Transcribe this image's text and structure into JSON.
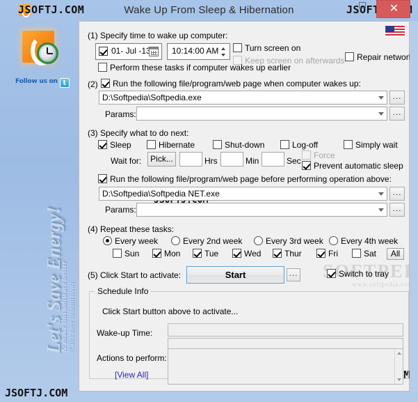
{
  "window": {
    "title": "Wake Up From Sleep & Hibernation",
    "watermark_titlebar_left": "JSOFTJ.COM",
    "watermark_titlebar_right": "JSOFTJ.COM",
    "watermark_bottom_left": "JSOFTJ.COM",
    "watermark_bottom_right": "JSOFTJ.COM",
    "watermark_middle": "JSOFTJ.COM",
    "close_label": "✕",
    "colors": {
      "close_button": "#d65a5c",
      "titlebar": "#a8c4e8",
      "panel": "#f0f0f0",
      "start_border": "#5f9ed1",
      "link": "#2222cc"
    }
  },
  "sidebar": {
    "follow_text": "Follow us on",
    "twitter_glyph": "t",
    "energy_big": "Let's Save Energy!",
    "energy_small1": "& make this software better",
    "energy_small2": "(Click here to learn how)"
  },
  "softpedia_watermark": {
    "line1": "SOFTPEDIA",
    "line2": "www.softpedia.com"
  },
  "step1": {
    "heading": "(1) Specify time to wake up computer:",
    "date_value": "01- Jul -13",
    "date_enabled": true,
    "time_value": "10:14:00 AM",
    "turn_screen_on": {
      "label": "Turn screen on",
      "checked": false
    },
    "keep_screen_on": {
      "label": "Keep screen on afterwards",
      "checked": false,
      "disabled": true
    },
    "repair_network": {
      "label": "Repair network",
      "checked": false
    },
    "perform_earlier": {
      "label": "Perform these tasks if computer wakes up earlier",
      "checked": false
    },
    "flag": "us-flag"
  },
  "step2": {
    "heading": "Run the following file/program/web page when computer wakes up:",
    "number": "(2)",
    "checked": true,
    "program_value": "D:\\Softpedia\\Softpedia.exe",
    "params_label": "Params:",
    "params_value": "",
    "browse_label": "..."
  },
  "step3": {
    "heading": "(3) Specify what to do next:",
    "options": [
      {
        "label": "Sleep",
        "checked": true
      },
      {
        "label": "Hibernate",
        "checked": false
      },
      {
        "label": "Shut-down",
        "checked": false
      },
      {
        "label": "Log-off",
        "checked": false
      },
      {
        "label": "Simply wait",
        "checked": false
      }
    ],
    "wait_for_label": "Wait for:",
    "pick_label": "Pick...",
    "hrs_value": "",
    "hrs_label": "Hrs",
    "min_value": "",
    "min_label": "Min",
    "sec_value": "",
    "sec_label": "Sec",
    "force": {
      "label": "Force",
      "checked": false,
      "disabled": true
    },
    "prevent_sleep": {
      "label": "Prevent automatic sleep",
      "checked": true
    },
    "before_heading": "Run the following file/program/web page before performing operation above:",
    "before_checked": true,
    "before_program_value": "D:\\Softpedia\\Softpedia NET.exe",
    "before_params_label": "Params:",
    "before_params_value": "",
    "browse_label": "..."
  },
  "step4": {
    "heading": "(4) Repeat these tasks:",
    "frequency": [
      {
        "label": "Every week",
        "selected": true
      },
      {
        "label": "Every 2nd week",
        "selected": false
      },
      {
        "label": "Every 3rd week",
        "selected": false
      },
      {
        "label": "Every 4th week",
        "selected": false
      }
    ],
    "days": [
      {
        "label": "Sun",
        "checked": false
      },
      {
        "label": "Mon",
        "checked": true
      },
      {
        "label": "Tue",
        "checked": true
      },
      {
        "label": "Wed",
        "checked": true
      },
      {
        "label": "Thur",
        "checked": true
      },
      {
        "label": "Fri",
        "checked": true
      },
      {
        "label": "Sat",
        "checked": false
      }
    ],
    "all_label": "All"
  },
  "step5": {
    "heading": "(5) Click Start to activate:",
    "start_label": "Start",
    "more_label": "...",
    "switch_to_tray": {
      "label": "Switch to tray",
      "checked": true
    }
  },
  "schedule_info": {
    "legend": "Schedule Info",
    "status": "Click Start button above to activate...",
    "wakeup_label": "Wake-up Time:",
    "wakeup_value": "",
    "wakeup_value2": "",
    "actions_label": "Actions to perform:",
    "actions_value": "",
    "view_all_label": "[View All]"
  }
}
